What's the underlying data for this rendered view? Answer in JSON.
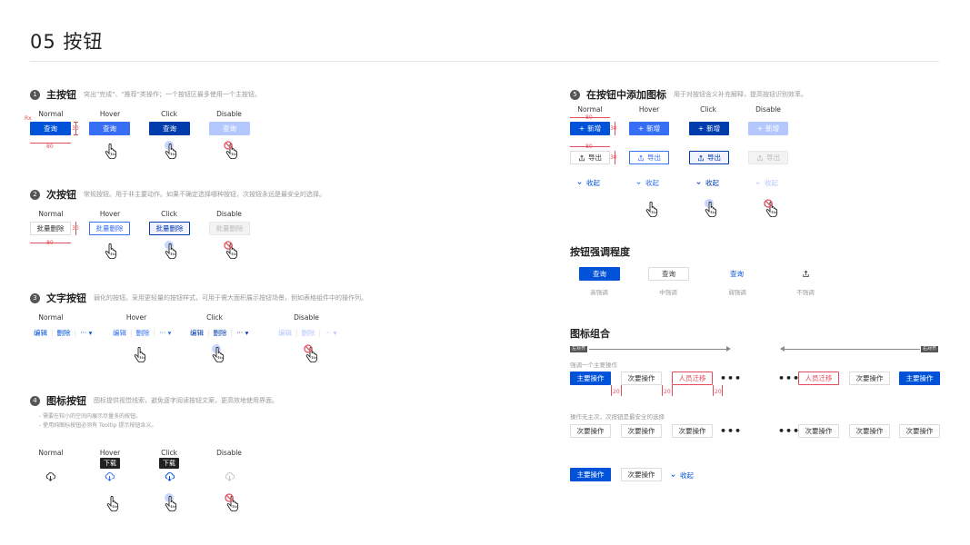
{
  "page_title": "05 按钮",
  "states": {
    "normal": "Normal",
    "hover": "Hover",
    "click": "Click",
    "disable": "Disable"
  },
  "dims": {
    "w80": "80",
    "h30": "30",
    "w20": "20"
  },
  "s1": {
    "num": "1",
    "title": "主按钮",
    "desc": "突出\"完成\"、\"推荐\"类操作；一个按钮区最多使用一个主按钮。",
    "btn": "查询",
    "mark": "Rx"
  },
  "s2": {
    "num": "2",
    "title": "次按钮",
    "desc": "常规按钮。用于非主要动作。如果不确定选择哪种按钮，次按钮永远是最安全的选择。",
    "btn": "批量删除"
  },
  "s3": {
    "num": "3",
    "title": "文字按钮",
    "desc": "弱化的按钮。采用更轻量的按钮样式，可用于需大面积展示按钮场景，例如表格组件中的操作列。",
    "edit": "编辑",
    "del": "删除",
    "more": "···",
    "sep": "|",
    "caret": "▾"
  },
  "s4": {
    "num": "4",
    "title": "图标按钮",
    "desc": "图标提供视觉线索，避免逐字阅读按钮文案，更高效地使用界面。",
    "note1": "- 需要在较小的空间内展示尽量多的按钮。",
    "note2": "- 使用纯图标按钮必须有 Tooltip 提示按钮含义。",
    "tooltip": "下载"
  },
  "s5": {
    "num": "5",
    "title": "在按钮中添加图标",
    "desc": "用于对按钮含义补充解释，提高按钮识别效率。",
    "add": "新增",
    "export": "导出",
    "collapse": "收起",
    "plus": "+"
  },
  "emphasis": {
    "title": "按钮强调程度",
    "btn": "查询",
    "levels": [
      "高强调",
      "中强调",
      "弱强调",
      "不强调"
    ]
  },
  "combo": {
    "title": "图标组合",
    "left_align": "左对齐",
    "right_align": "右对齐",
    "line1": "强调一个主要操作",
    "line2": "操作无主次，次按钮是最安全的选择",
    "primary": "主要操作",
    "secondary": "次要操作",
    "danger": "人员迁移",
    "dots": "•••",
    "collapse": "收起"
  },
  "colors": {
    "primary": "#0052d9",
    "hover": "#366ef4",
    "click": "#003cab",
    "disable": "#b5c7ff",
    "danger": "#e34d59"
  }
}
